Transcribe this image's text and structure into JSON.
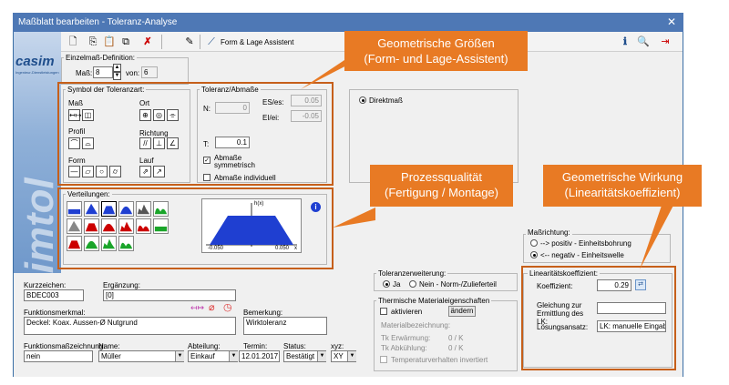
{
  "window": {
    "title": "Maßblatt bearbeiten - Toleranz-Analyse",
    "close_glyph": "✕"
  },
  "toolbar": {
    "assistant_label": "Form & Lage Assistent",
    "icons": [
      "new-document-icon",
      "copy-icon",
      "paste-icon",
      "copy-all-icon",
      "delete-icon",
      "pen-icon",
      "form-lage-assistant-icon",
      "info-icon",
      "search-icon",
      "exit-icon"
    ]
  },
  "sidebar": {
    "logo": "casim",
    "logo_sub": "Ingenieur-Dienstleistungen",
    "watermark": "simtol"
  },
  "einzelmass": {
    "group_label": "Einzelmaß-Definition:",
    "mass_label": "Maß:",
    "mass_value": "8",
    "von_label": "von:",
    "von_value": "6"
  },
  "symbol": {
    "group_label": "Symbol der Toleranzart:",
    "mass_label": "Maß",
    "ort_label": "Ort",
    "profil_label": "Profil",
    "richtung_label": "Richtung",
    "form_label": "Form",
    "lauf_label": "Lauf",
    "mass_glyphs": [
      "↤↦",
      "◫"
    ],
    "ort_glyphs": [
      "⊕",
      "◎",
      "⌯"
    ],
    "profil_glyphs": [
      "⌒",
      "⌓"
    ],
    "richtung_glyphs": [
      "//",
      "⊥",
      "∠"
    ],
    "form_glyphs": [
      "—",
      "▱",
      "○",
      "⌭"
    ],
    "lauf_glyphs": [
      "⇗",
      "↗"
    ]
  },
  "toleranz": {
    "group_label": "Toleranz/Abmaße",
    "n_label": "N:",
    "n_value": "0",
    "es_label": "ES/es:",
    "es_value": "0.05",
    "ei_label": "EI/ei:",
    "ei_value": "-0.05",
    "t_label": "T:",
    "t_value": "0.1",
    "symm_label": "Abmaße symmetrisch",
    "indiv_label": "Abmaße individuell"
  },
  "direkt": {
    "label": "Direktmaß"
  },
  "verteilungen": {
    "group_label": "Verteilungen:",
    "chart_axis_label": "h(x)",
    "min_label": "-0.050",
    "max_label": "0.050",
    "x_label": "x"
  },
  "massrichtung": {
    "group_label": "Maßrichtung:",
    "positiv_label": "--> positiv - Einheitsbohrung",
    "negativ_label": "<-- negativ - Einheitswelle"
  },
  "linearitaet": {
    "group_label": "Linearitätskoeffizient:",
    "koeff_label": "Koeffizient:",
    "koeff_value": "0.29",
    "gleichung_label": "Gleichung zur Ermittlung des LK:",
    "gleichung_value": "",
    "loesung_label": "Lösungsansatz:",
    "loesung_value": "LK: manuelle Eingabe"
  },
  "toleranzerweiterung": {
    "group_label": "Toleranzerweiterung:",
    "ja_label": "Ja",
    "nein_label": "Nein - Norm-/Zulieferteil"
  },
  "thermisch": {
    "group_label": "Thermische Materialeigenschaften",
    "aktivieren_label": "aktivieren",
    "aendern_label": "ändern",
    "material_label": "Materialbezeichnung:",
    "erw_label": "Tk Erwärmung:",
    "erw_value": "0 / K",
    "abk_label": "Tk Abkühlung:",
    "abk_value": "0 / K",
    "invert_label": "Temperaturverhalten invertiert"
  },
  "fields": {
    "kurzzeichen_label": "Kurzzeichen:",
    "kurzzeichen_value": "BDEC003",
    "ergaenzung_label": "Ergänzung:",
    "ergaenzung_value": "[0]",
    "funktionsmerkmal_label": "Funktionsmerkmal:",
    "funktionsmerkmal_value": "Deckel: Koax. Aussen-Ø Nutgrund",
    "bemerkung_label": "Bemerkung:",
    "bemerkung_value": "Wirktoleranz",
    "fmz_label": "Funktionsmaßzeichnung:",
    "fmz_value": "nein",
    "name_label": "Name:",
    "name_value": "Müller",
    "abteilung_label": "Abteilung:",
    "abteilung_value": "Einkauf",
    "termin_label": "Termin:",
    "termin_value": "12.01.2017",
    "status_label": "Status:",
    "status_value": "Bestätigt",
    "xyz_label": "xyz:",
    "xyz_value": "XY"
  },
  "callouts": {
    "geo_groessen": "Geometrische Größen\n(Form- und Lage-Assistent)",
    "prozess": "Prozessqualität\n(Fertigung / Montage)",
    "wirkung": "Geometrische Wirkung\n(Linearitätskoeffizient)"
  },
  "colors": {
    "accent_orange": "#e87a24",
    "frame_orange": "#c65f1a",
    "title_blue": "#4e78b5",
    "dist_blue": "#1f3fd1"
  }
}
